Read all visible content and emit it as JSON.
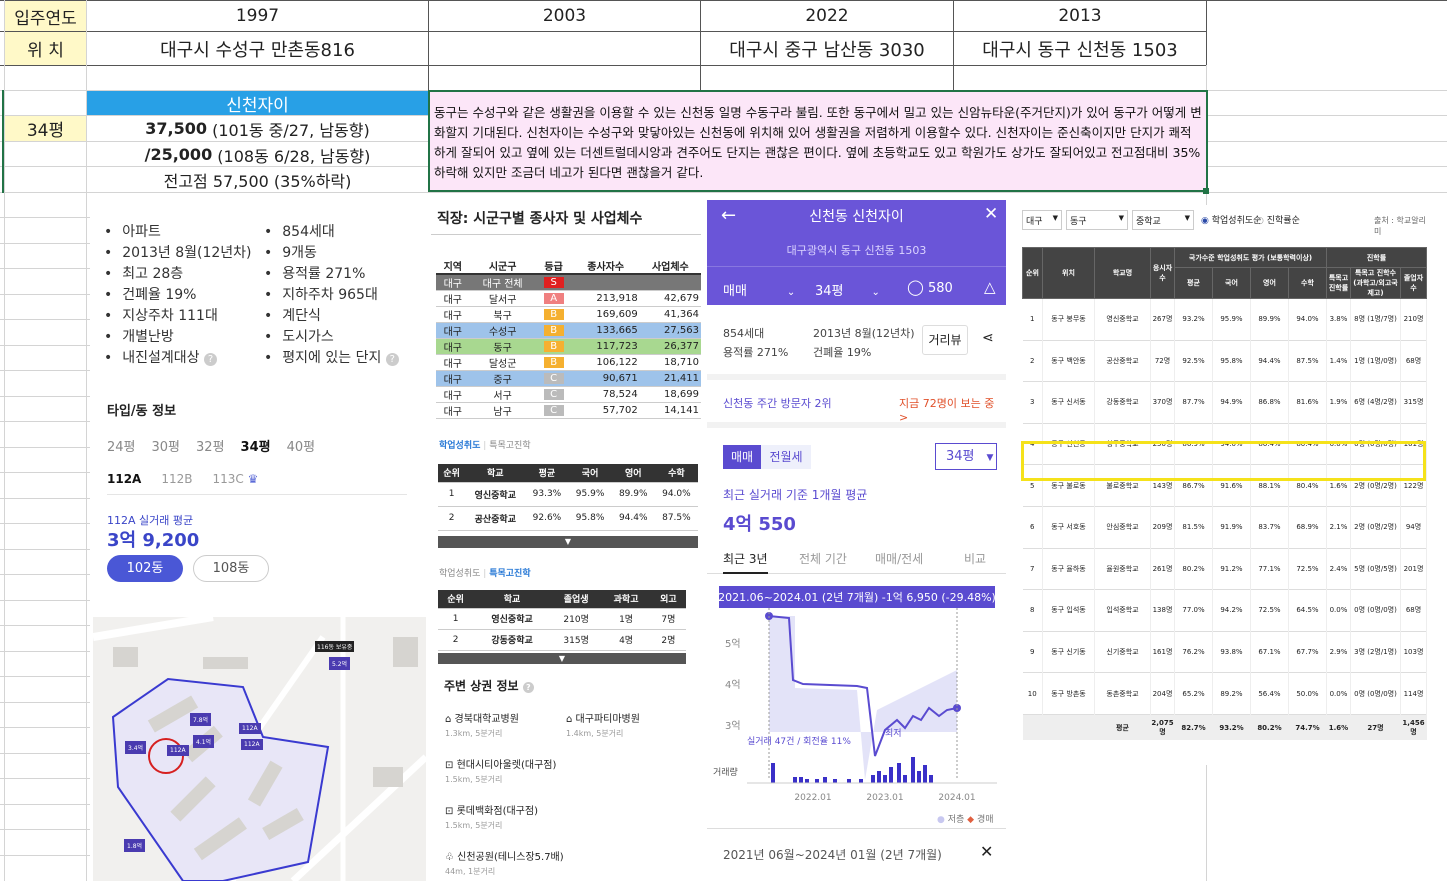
{
  "sheet": {
    "row1": {
      "label": "입주연도",
      "c1": "1997",
      "c2": "2003",
      "c3": "2022",
      "c4": "2013"
    },
    "row2": {
      "label": "위  치",
      "c1": "대구시 수성구 만촌동816",
      "c2": "",
      "c3": "대구시 중구 남산동 3030",
      "c4": "대구시 동구 신천동 1503"
    },
    "size": "34평",
    "apt_name": "신천자이",
    "price1": "37,500",
    "price1_note": "(101동 중/27, 남동향)",
    "price2_prefix": "/ ",
    "price2": "25,000",
    "price2_note": "(108동 6/28, 남동향)",
    "price3": "전고점 57,500 (35%하락)",
    "memo": "동구는 수성구와 같은 생활권을 이용할 수 있는 신천동 일명 수동구라 불림. 또한 동구에서 밀고 있는 신암뉴타운(주거단지)가 있어 동구가 어떻게 변화할지 기대된다. 신천자이는 수성구와 맞닿아있는 신천동에 위치해 있어 생활권을 저렴하게 이용할수 있다. 신천자이는 준신축이지만 단지가 쾌적하게 잘되어 있고 옆에 있는 더센트럴데시앙과 견주어도 단지는 괜찮은 편이다. 옆에 초등학교도 있고 학원가도 상가도 잘되어있고 전고점대비 35%하락해 있지만 조금더 네고가 된다면 괜찮을거 같다."
  },
  "info": {
    "col1": [
      "아파트",
      "2013년 8월(12년차)",
      "최고 28층",
      "건폐율 19%",
      "지상주차 111대",
      "개별난방",
      "내진설계대상"
    ],
    "col2": [
      "854세대",
      "9개동",
      "용적률 271%",
      "지하주차 965대",
      "계단식",
      "도시가스",
      "평지에 있는 단지"
    ],
    "type_title": "타입/동 정보",
    "pyeong_tabs": [
      "24평",
      "30평",
      "32평",
      "34평",
      "40평"
    ],
    "type_tabs": [
      "112A",
      "112B",
      "113C"
    ],
    "avg_label": "112A 실거래 평균",
    "avg_value": "3억 9,200",
    "dong_buttons": [
      "102동",
      "108동"
    ]
  },
  "map": {
    "labels": [
      "116동 보유중",
      "5.2억",
      "7.8억",
      "4.1억",
      "112A",
      "3.4억",
      "1.8억",
      "112A",
      "112A"
    ]
  },
  "work": {
    "title": "직장: 시군구별 종사자 및 사업체수",
    "headers": [
      "지역",
      "시군구",
      "등급",
      "종사자수",
      "사업체수"
    ],
    "rows": [
      [
        "대구",
        "대구 전체",
        "S",
        "",
        ""
      ],
      [
        "대구",
        "달서구",
        "A",
        "213,918",
        "42,679"
      ],
      [
        "대구",
        "북구",
        "B",
        "169,609",
        "41,364"
      ],
      [
        "대구",
        "수성구",
        "B",
        "133,665",
        "27,563"
      ],
      [
        "대구",
        "동구",
        "B",
        "117,723",
        "26,377"
      ],
      [
        "대구",
        "달성군",
        "B",
        "106,122",
        "18,710"
      ],
      [
        "대구",
        "중구",
        "C",
        "90,671",
        "21,411"
      ],
      [
        "대구",
        "서구",
        "C",
        "78,524",
        "18,699"
      ],
      [
        "대구",
        "남구",
        "C",
        "57,702",
        "14,141"
      ]
    ]
  },
  "school1": {
    "tabs": [
      "학업성취도",
      "특목고진학"
    ],
    "headers": [
      "순위",
      "학교",
      "평균",
      "국어",
      "영어",
      "수학"
    ],
    "rows": [
      [
        "1",
        "영신중학교",
        "93.3%",
        "95.9%",
        "89.9%",
        "94.0%"
      ],
      [
        "2",
        "공산중학교",
        "92.6%",
        "95.8%",
        "94.4%",
        "87.5%"
      ]
    ]
  },
  "school2": {
    "tabs": [
      "학업성취도",
      "특목고진학"
    ],
    "headers": [
      "순위",
      "학교",
      "졸업생",
      "과학고",
      "외고"
    ],
    "rows": [
      [
        "1",
        "영신중학교",
        "210명",
        "1명",
        "7명"
      ],
      [
        "2",
        "강동중학교",
        "315명",
        "4명",
        "2명"
      ]
    ]
  },
  "shops": {
    "title": "주변 상권 정보",
    "items": [
      {
        "name": "경북대학교병원",
        "dist": "1.3km, 5분거리"
      },
      {
        "name": "대구파티마병원",
        "dist": "1.4km, 5분거리"
      },
      {
        "name": "현대시티아울렛(대구점)",
        "dist": "1.5km, 5분거리"
      },
      {
        "name": "롯데백화점(대구점)",
        "dist": "1.5km, 5분거리"
      },
      {
        "name": "신천공원(테니스장5.7배)",
        "dist": "44m, 1분거리"
      }
    ]
  },
  "app": {
    "title": "신천동 신천자이",
    "address": "대구광역시 동구 신천동 1503",
    "trade": "매매",
    "size": "34평",
    "comments": "580",
    "households": "854세대",
    "far": "용적률 271%",
    "built": "2013년 8월(12년차)",
    "bcr": "건폐율 19%",
    "street_btn": "거리뷰",
    "visitors": "신천동 주간 방문자 2위",
    "viewing": "지금 72명이 보는 중 >",
    "tabs": [
      "매매",
      "전월세"
    ],
    "size_select": "34평",
    "avg_label": "최근 실거래 기준 1개월 평균",
    "avg_value": "4억 550",
    "range_tabs": [
      "최근 3년",
      "전체 기간",
      "매매/전세",
      "비교"
    ],
    "banner": "2021.06~2024.01 (2년 7개월)  -1억 6,950 (-29.48%)",
    "y_labels": [
      "5억",
      "4억",
      "3억"
    ],
    "min_label": "최저",
    "volume_note": "실거래 47건 / 회전율 11%",
    "volume_label": "거래량",
    "x_labels": [
      "2022.01",
      "2023.01",
      "2024.01"
    ],
    "legend": [
      "저층",
      "경매"
    ],
    "footer": "2021년 06월~2024년 01월 (2년 7개월)"
  },
  "ranking": {
    "filters": [
      "대구",
      "동구",
      "중학교"
    ],
    "radio": [
      "학업성취도순",
      "진학률순"
    ],
    "source": "출처 : 학교알리미",
    "head_group1": "국가수준 학업성취도 평가 (보통학력이상)",
    "head_group2": "진학률",
    "headers": [
      "순위",
      "위치",
      "학교명",
      "응시자수",
      "평균",
      "국어",
      "영어",
      "수학",
      "특목고 진학률",
      "특목고 진학수 (과학고/외고국제고)",
      "졸업자수"
    ],
    "rows": [
      [
        "1",
        "동구 봉무동",
        "영신중학교",
        "267명",
        "93.2%",
        "95.9%",
        "89.9%",
        "94.0%",
        "3.8%",
        "8명 (1명/7명)",
        "210명"
      ],
      [
        "2",
        "동구 백안동",
        "공산중학교",
        "72명",
        "92.5%",
        "95.8%",
        "94.4%",
        "87.5%",
        "1.4%",
        "1명 (1명/0명)",
        "68명"
      ],
      [
        "3",
        "동구 신서동",
        "강동중학교",
        "370명",
        "87.7%",
        "94.9%",
        "86.8%",
        "81.6%",
        "1.9%",
        "6명 (4명/2명)",
        "315명"
      ],
      [
        "4",
        "동구 신천동",
        "청구중학교",
        "250명",
        "86.9%",
        "94.0%",
        "86.4%",
        "80.4%",
        "0.0%",
        "0명 (0명/0명)",
        "161명"
      ],
      [
        "5",
        "동구 불로동",
        "불로중학교",
        "143명",
        "86.7%",
        "91.6%",
        "88.1%",
        "80.4%",
        "1.6%",
        "2명 (0명/2명)",
        "122명"
      ],
      [
        "6",
        "동구 서호동",
        "안심중학교",
        "209명",
        "81.5%",
        "91.9%",
        "83.7%",
        "68.9%",
        "2.1%",
        "2명 (0명/2명)",
        "94명"
      ],
      [
        "7",
        "동구 율하동",
        "율원중학교",
        "261명",
        "80.2%",
        "91.2%",
        "77.1%",
        "72.5%",
        "2.4%",
        "5명 (0명/5명)",
        "201명"
      ],
      [
        "8",
        "동구 입석동",
        "입석중학교",
        "138명",
        "77.0%",
        "94.2%",
        "72.5%",
        "64.5%",
        "0.0%",
        "0명 (0명/0명)",
        "68명"
      ],
      [
        "9",
        "동구 신기동",
        "신기중학교",
        "161명",
        "76.2%",
        "93.8%",
        "67.1%",
        "67.7%",
        "2.9%",
        "3명 (2명/1명)",
        "103명"
      ],
      [
        "10",
        "동구 방촌동",
        "동촌중학교",
        "204명",
        "65.2%",
        "89.2%",
        "56.4%",
        "50.0%",
        "0.0%",
        "0명 (0명/0명)",
        "114명"
      ]
    ],
    "avg_row": [
      "",
      "",
      "평균",
      "2,075명",
      "82.7%",
      "93.2%",
      "80.2%",
      "74.7%",
      "1.6%",
      "27명",
      "1,456명"
    ]
  },
  "colors": {
    "accent": "#28a0e6",
    "purple": "#6a55d8",
    "memo_bg": "#fce6f8",
    "memo_border": "#217346",
    "highlight": "#f5e21a"
  }
}
